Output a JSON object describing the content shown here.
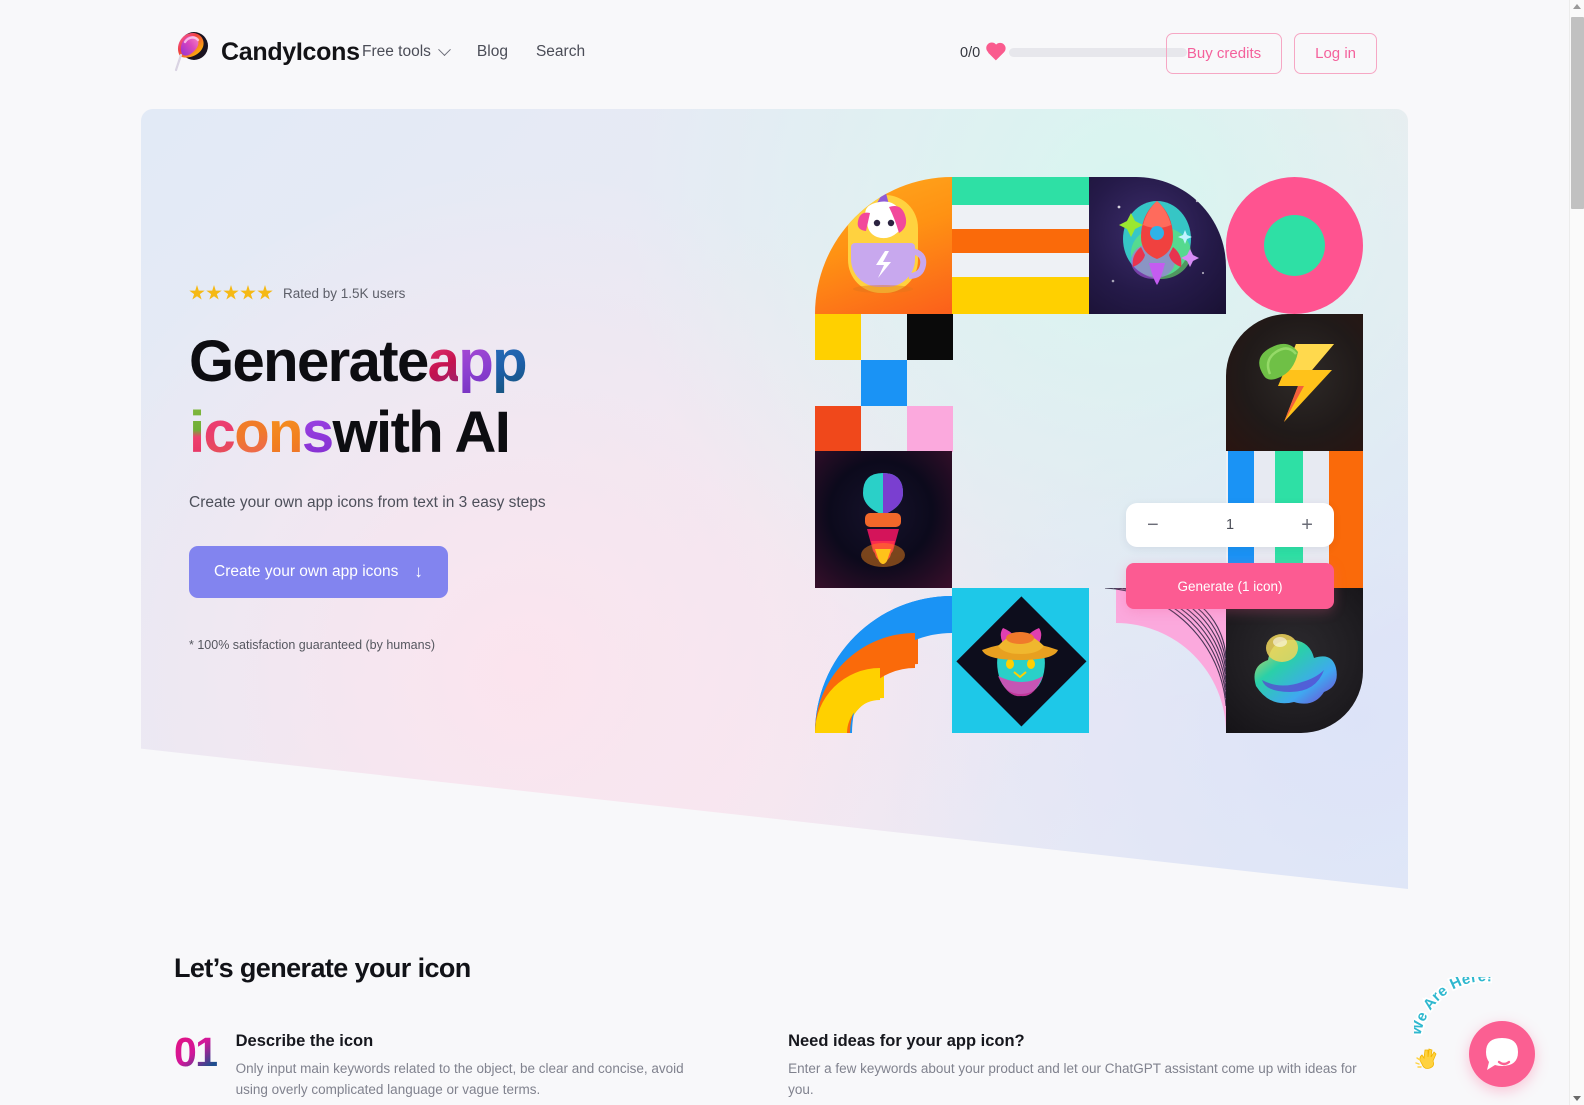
{
  "header": {
    "brand": "CandyIcons",
    "logo_icon": "candy-swirl-logo",
    "nav": [
      {
        "label": "Free tools",
        "has_dropdown": true
      },
      {
        "label": "Blog",
        "has_dropdown": false
      },
      {
        "label": "Search",
        "has_dropdown": false
      }
    ],
    "credits": {
      "count": "0/0",
      "icon": "heart-icon",
      "bar_fill_percent": 0
    },
    "buttons": [
      {
        "label": "Buy credits",
        "name": "buy-credits-button"
      },
      {
        "label": "Log in",
        "name": "log-in-button"
      }
    ],
    "accent_pink": "#f4619c"
  },
  "hero": {
    "rating": {
      "stars": 5,
      "text": "Rated by 1.5K users",
      "star_color": "#f5b914"
    },
    "headline": {
      "line1_plain": "Generate ",
      "line1_colored": [
        {
          "char": "a",
          "color": "#d4145a"
        },
        {
          "char": "p",
          "color": "#8b3fd0"
        },
        {
          "char": "p",
          "color": "#1d5fa8"
        }
      ],
      "line2_colored": [
        {
          "char": "i",
          "color": "#6fae37"
        },
        {
          "char": "c",
          "color": "#ea3c6e"
        },
        {
          "char": "o",
          "color": "#f07a2b"
        },
        {
          "char": "n",
          "color": "#f2801f"
        },
        {
          "char": "s",
          "color": "#8f38da"
        }
      ],
      "line2_plain": " with AI"
    },
    "subhead": "Create your own app icons from text in 3 easy steps",
    "cta_label": "Create your own app icons",
    "cta_arrow_icon": "arrow-down-icon",
    "cta_color": "#8284ef",
    "guarantee": "* 100% satisfaction guaranteed (by humans)"
  },
  "generator": {
    "decrement_label": "−",
    "increment_label": "+",
    "quantity": "1",
    "generate_label": "Generate (1 icon)",
    "generate_color": "#fc5b92"
  },
  "mosaic": {
    "tiles": [
      {
        "name": "unicorn-cup-icon-tile",
        "desc": "unicorn in teacup on orange"
      },
      {
        "name": "horizontal-stripes-tile",
        "desc": "green orange yellow stripes"
      },
      {
        "name": "rocket-icon-tile",
        "desc": "rocket in space"
      },
      {
        "name": "donut-shape-tile",
        "desc": "pink ring with green center"
      },
      {
        "name": "leaf-bolt-icon-tile",
        "desc": "leaf and lightning bolt on dark"
      },
      {
        "name": "lamp-icon-tile",
        "desc": "glowing lamp on dark"
      },
      {
        "name": "vertical-stripes-tile",
        "desc": "blue green orange vertical stripes"
      },
      {
        "name": "rainbow-arc-tile",
        "desc": "yellow orange blue arcs"
      },
      {
        "name": "cat-hat-icon-tile",
        "desc": "cat with hat on cyan diamond"
      },
      {
        "name": "concentric-lines-tile",
        "desc": "pink arc with line pattern"
      },
      {
        "name": "blob-cloud-icon-tile",
        "desc": "gradient blob on dark"
      },
      {
        "name": "checker-squares-tile",
        "desc": "yellow black blue orange pink squares"
      }
    ]
  },
  "steps_section": {
    "title": "Let’s generate your icon",
    "step": {
      "number": "01",
      "title": "Describe the icon",
      "description": "Only input main keywords related to the object, be clear and concise, avoid using overly complicated language or vague terms."
    },
    "ideas": {
      "title": "Need ideas for your app icon?",
      "description": "Enter a few keywords about your product and let our ChatGPT assistant come up with ideas for you."
    }
  },
  "chat_widget": {
    "label": "We Are Here!",
    "hand_icon": "waving-hand-icon",
    "bubble_icon": "chat-bubble-icon",
    "color": "#fb5f92"
  }
}
